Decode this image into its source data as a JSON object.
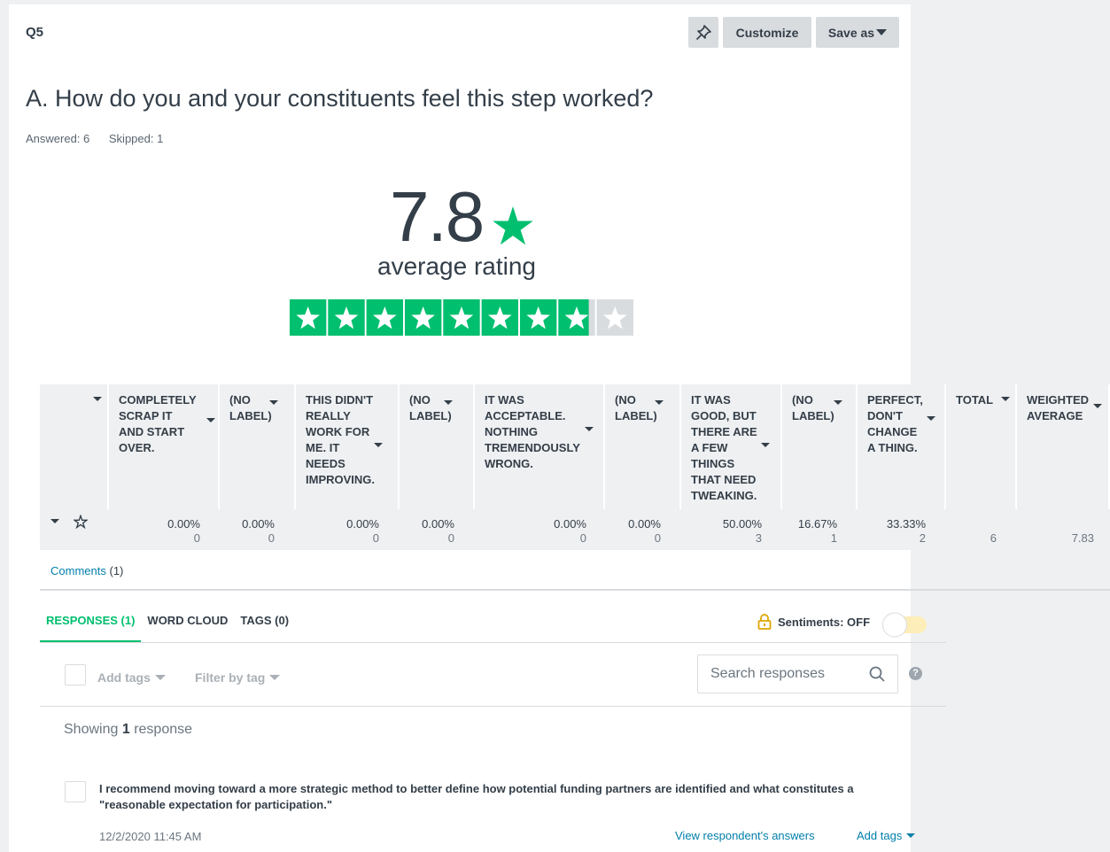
{
  "question": {
    "number": "Q5",
    "title": "A. How do you and your constituents feel this step worked?",
    "answered": "Answered: 6",
    "skipped": "Skipped: 1"
  },
  "toolbar": {
    "customize": "Customize",
    "save_as": "Save as"
  },
  "rating": {
    "value": "7.8",
    "label": "average rating",
    "stars_total": 9,
    "stars_filled": 7.83,
    "star_color": "#00bf6f",
    "empty_star_color": "#d9dcdf"
  },
  "table": {
    "columns": [
      "COMPLETELY SCRAP IT AND START OVER.",
      "(NO LABEL)",
      "THIS DIDN'T REALLY WORK FOR ME. IT NEEDS IMPROVING.",
      "(NO LABEL)",
      "IT WAS ACCEPTABLE. NOTHING TREMENDOUSLY WRONG.",
      "(NO LABEL)",
      "IT WAS GOOD, BUT THERE ARE A FEW THINGS THAT NEED TWEAKING.",
      "(NO LABEL)",
      "PERFECT, DON'T CHANGE A THING.",
      "TOTAL",
      "WEIGHTED AVERAGE"
    ],
    "row": {
      "percents": [
        "0.00%",
        "0.00%",
        "0.00%",
        "0.00%",
        "0.00%",
        "0.00%",
        "50.00%",
        "16.67%",
        "33.33%",
        "",
        ""
      ],
      "counts": [
        "0",
        "0",
        "0",
        "0",
        "0",
        "0",
        "3",
        "1",
        "2",
        "6",
        "7.83"
      ]
    }
  },
  "comments": {
    "label": "Comments",
    "count": "(1)"
  },
  "tabs": [
    "RESPONSES (1)",
    "WORD CLOUD",
    "TAGS (0)"
  ],
  "sentiments": "Sentiments: OFF",
  "filters": {
    "add_tags": "Add tags",
    "filter_by_tag": "Filter by tag"
  },
  "search": {
    "placeholder": "Search responses"
  },
  "help": "?",
  "showing": {
    "prefix": "Showing",
    "count": "1",
    "suffix": "response"
  },
  "response": {
    "text": "I recommend moving toward a more strategic method to better define how potential funding partners are identified and what constitutes a \"reasonable expectation for participation.\"",
    "date": "12/2/2020 11:45 AM",
    "view_link": "View respondent's answers",
    "add_tags": "Add tags"
  },
  "colors": {
    "accent": "#00bf6f",
    "link": "#007faa",
    "toggle_track": "#fdeeb9"
  }
}
